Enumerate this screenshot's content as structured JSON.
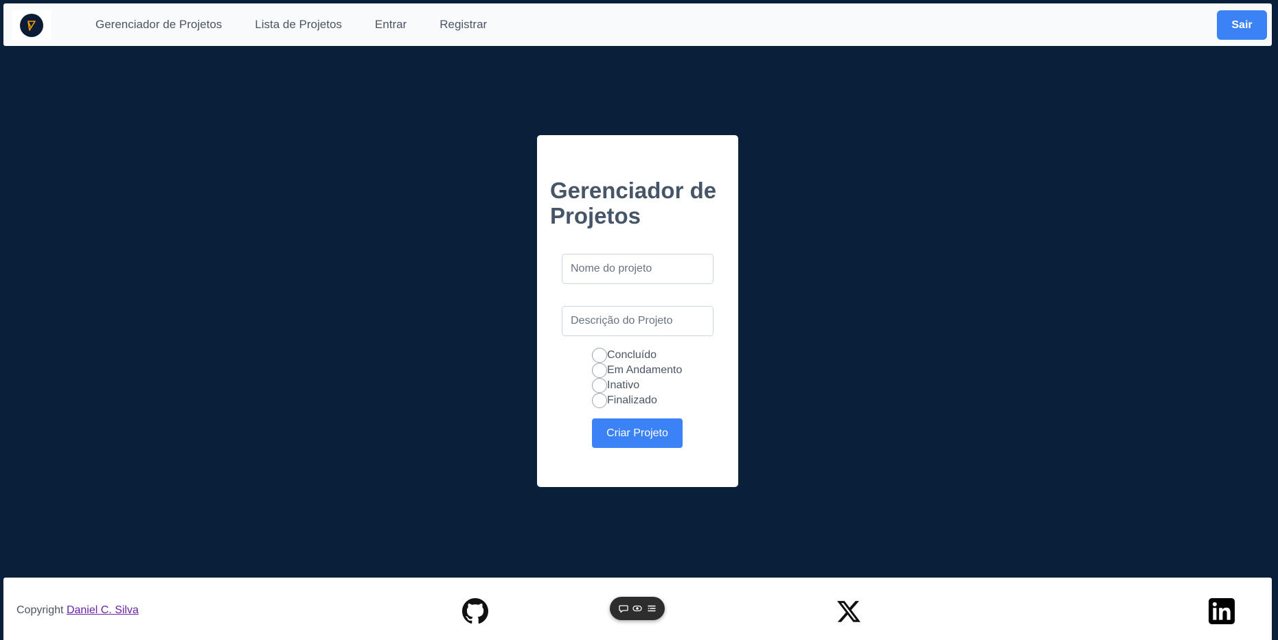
{
  "navbar": {
    "logo_icon": "pen-logo-icon",
    "links": [
      "Gerenciador de Projetos",
      "Lista de Projetos",
      "Entrar",
      "Registrar"
    ],
    "logout_label": "Sair"
  },
  "form": {
    "title": "Gerenciador de Projetos",
    "name_placeholder": "Nome do projeto",
    "description_placeholder": "Descrição do Projeto",
    "status_options": [
      "Concluído",
      "Em Andamento",
      "Inativo",
      "Finalizado"
    ],
    "submit_label": "Criar Projeto"
  },
  "footer": {
    "copyright_prefix": "Copyright",
    "author": "Daniel C. Silva",
    "social_icons": [
      "github-icon",
      "x-twitter-icon",
      "linkedin-icon"
    ]
  },
  "floating_toolbar": {
    "icons": [
      "chat-icon",
      "eye-icon",
      "menu-icon"
    ]
  },
  "colors": {
    "background": "#0a203a",
    "accent": "#3b82f6",
    "title_text": "#475569",
    "link_visited": "#6b21a8"
  }
}
